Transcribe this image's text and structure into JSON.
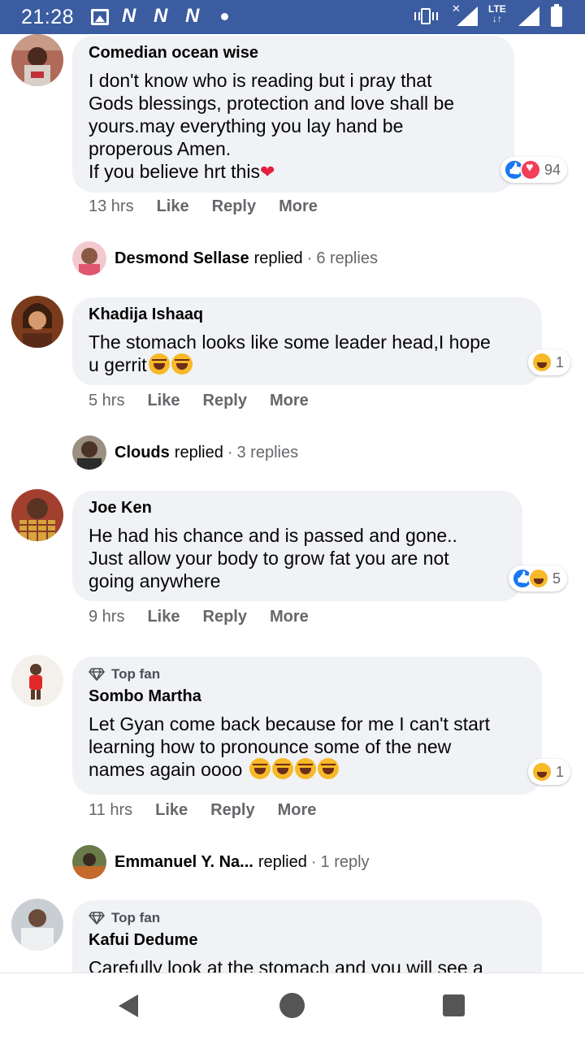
{
  "status_bar": {
    "time": "21:28",
    "notification_letters": [
      "N",
      "N",
      "N"
    ],
    "network": "LTE"
  },
  "comments": [
    {
      "author": "Comedian ocean wise",
      "top_fan": false,
      "text_lines": [
        "I don't know who is reading but i pray that",
        "Gods blessings, protection and love shall be",
        "yours.may everything you lay hand be",
        "properous Amen.",
        "If you believe hrt this"
      ],
      "trailing_emoji": "heart",
      "reactions": [
        "like",
        "love"
      ],
      "reaction_count": "94",
      "time": "13 hrs",
      "actions": [
        "Like",
        "Reply",
        "More"
      ],
      "replies": {
        "name": "Desmond Sellase",
        "replied": "replied",
        "count": "6 replies"
      }
    },
    {
      "author": "Khadija Ishaaq",
      "top_fan": false,
      "text_lines": [
        "The stomach looks like some leader head,I hope",
        "u gerrit"
      ],
      "trailing_emoji": "laugh",
      "trailing_emoji_count": 2,
      "reactions": [
        "haha"
      ],
      "reaction_count": "1",
      "time": "5 hrs",
      "actions": [
        "Like",
        "Reply",
        "More"
      ],
      "replies": {
        "name": "Clouds",
        "replied": "replied",
        "count": "3 replies"
      }
    },
    {
      "author": "Joe Ken",
      "top_fan": false,
      "text_lines": [
        "He had his chance and is passed and gone..",
        "Just allow your body to grow fat you are not",
        "going anywhere"
      ],
      "reactions": [
        "like",
        "haha"
      ],
      "reaction_count": "5",
      "time": "9 hrs",
      "actions": [
        "Like",
        "Reply",
        "More"
      ]
    },
    {
      "author": "Sombo Martha",
      "top_fan": true,
      "top_fan_label": "Top fan",
      "text_lines": [
        "Let Gyan come back because for me I can't start",
        "learning how to pronounce some of the new",
        "names again oooo"
      ],
      "trailing_emoji": "laugh",
      "trailing_emoji_count": 4,
      "reactions": [
        "haha"
      ],
      "reaction_count": "1",
      "time": "11 hrs",
      "actions": [
        "Like",
        "Reply",
        "More"
      ],
      "replies": {
        "name": "Emmanuel Y. Na...",
        "replied": "replied",
        "count": "1 reply"
      }
    },
    {
      "author": "Kafui Dedume",
      "top_fan": true,
      "top_fan_label": "Top fan",
      "text_lines": [
        "Carefully look at the stomach and you will see a"
      ]
    }
  ],
  "colors": {
    "status_bar": "#3b5ca0",
    "bubble": "#f0f2f5",
    "secondary_text": "#65676b",
    "like_blue": "#1877f2",
    "love_red": "#f33e58",
    "haha_yellow": "#f7b928"
  }
}
